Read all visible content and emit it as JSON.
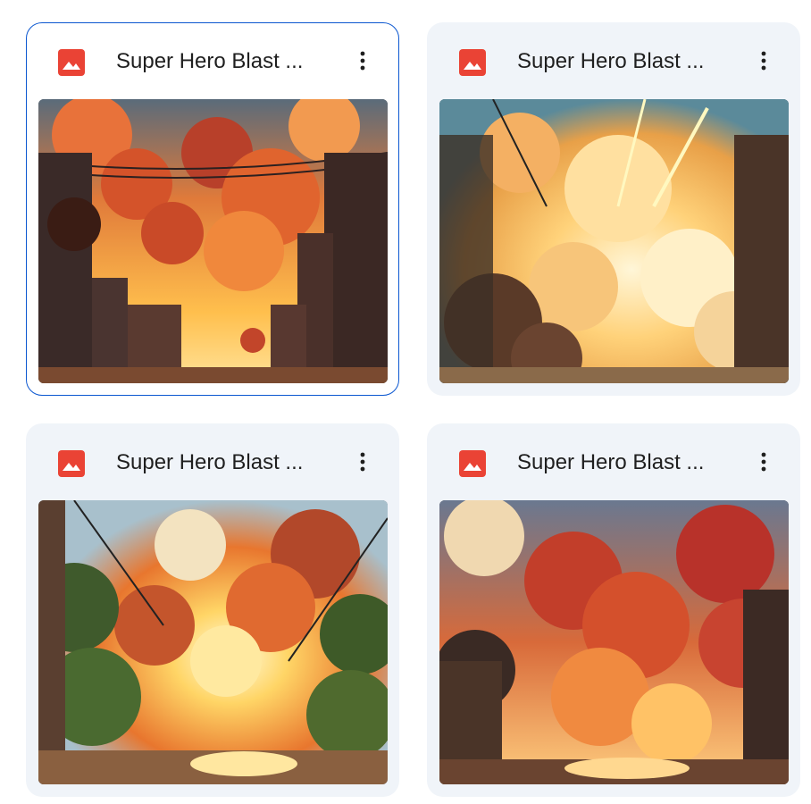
{
  "files": [
    {
      "title": "Super Hero Blast ...",
      "selected": true
    },
    {
      "title": "Super Hero Blast ...",
      "selected": false
    },
    {
      "title": "Super Hero Blast ...",
      "selected": false
    },
    {
      "title": "Super Hero Blast ...",
      "selected": false
    }
  ],
  "icons": {
    "file_type": "image-file-icon",
    "menu": "more-vert-icon"
  },
  "colors": {
    "card_bg": "#f0f4f9",
    "selected_border": "#0b57d0",
    "image_icon": "#ea4335"
  }
}
